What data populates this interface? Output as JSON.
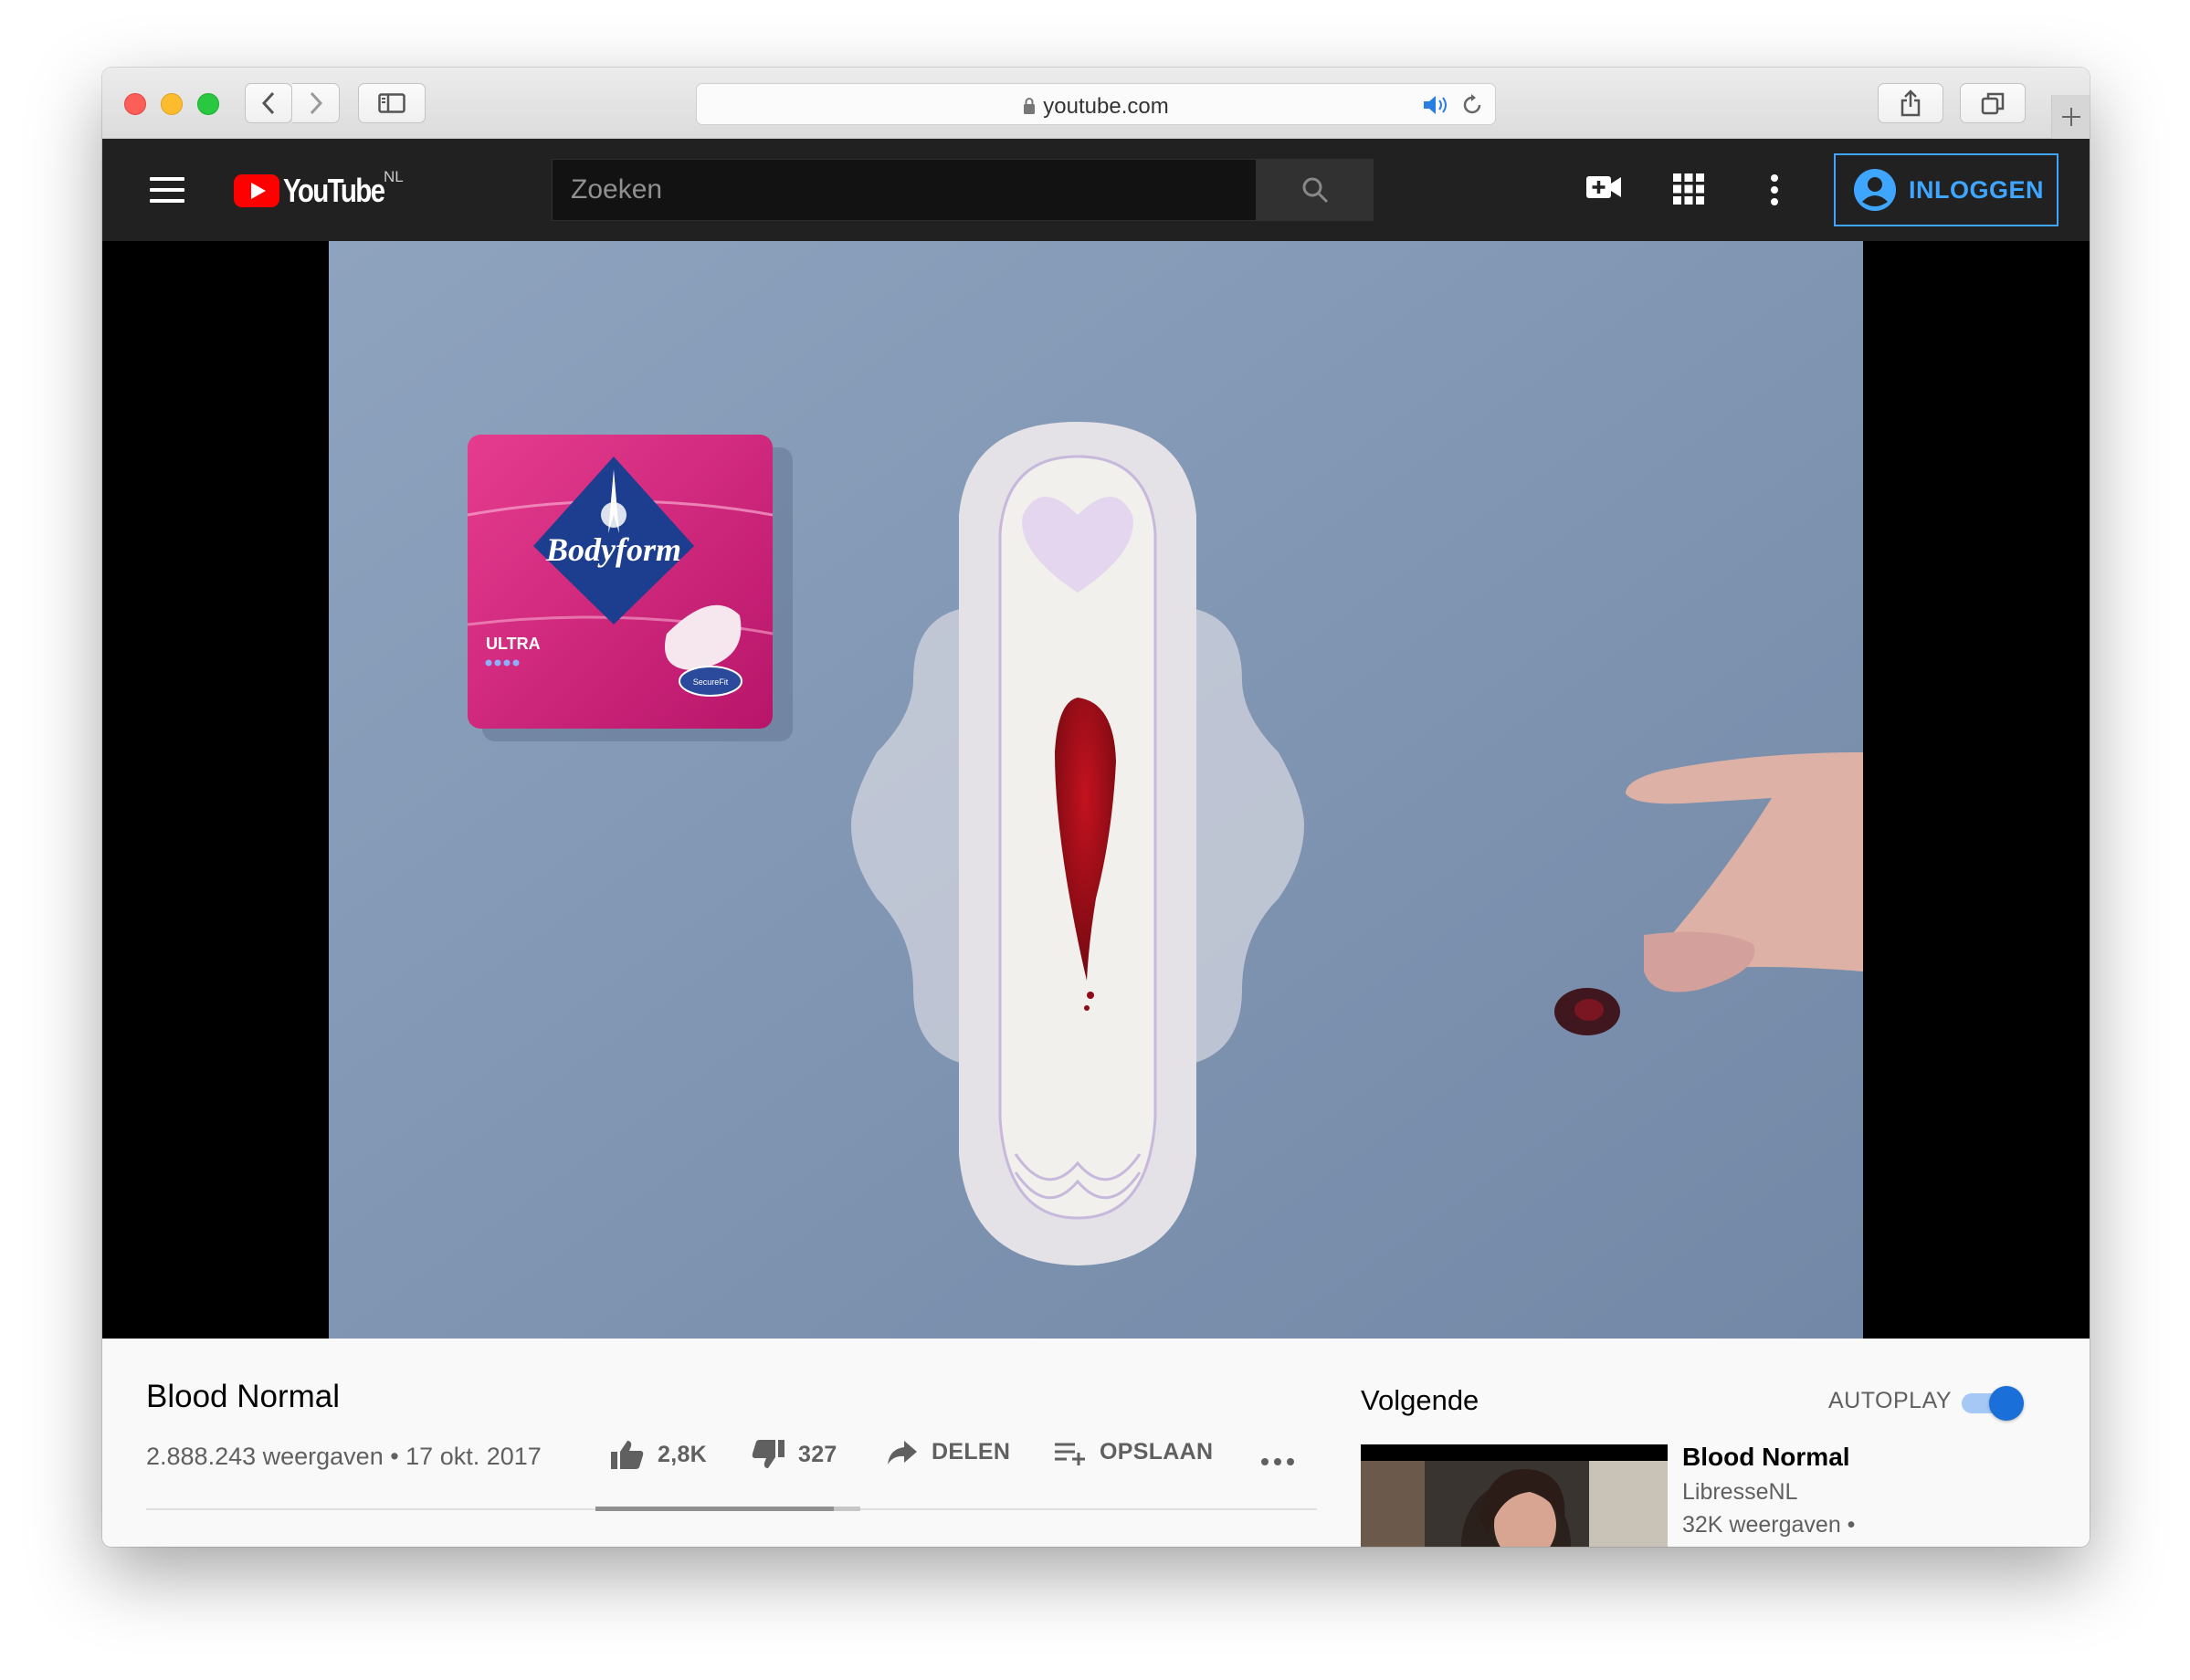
{
  "browser": {
    "url": "youtube.com",
    "colors": {
      "red": "#fc5f57",
      "yellow": "#fdbc2e",
      "green": "#29c840"
    }
  },
  "header": {
    "logo_text": "YouTube",
    "region": "NL",
    "search_placeholder": "Zoeken",
    "login_label": "INLOGGEN",
    "accent": "#3ea6ff"
  },
  "video": {
    "title": "Blood Normal",
    "meta": "2.888.243 weergaven • 17 okt. 2017",
    "likes": "2,8K",
    "dislikes": "327",
    "share_label": "DELEN",
    "save_label": "OPSLAAN",
    "like_ratio": 0.9,
    "frame_background": "#7f96b3",
    "product": {
      "brand": "Bodyform",
      "variant": "ULTRA",
      "badge": "SecureFit"
    }
  },
  "sidebar": {
    "up_next_label": "Volgende",
    "autoplay_label": "AUTOPLAY",
    "autoplay_on": true,
    "recommendation": {
      "title": "Blood Normal",
      "channel": "LibresseNL",
      "views": "32K weergaven •"
    }
  }
}
